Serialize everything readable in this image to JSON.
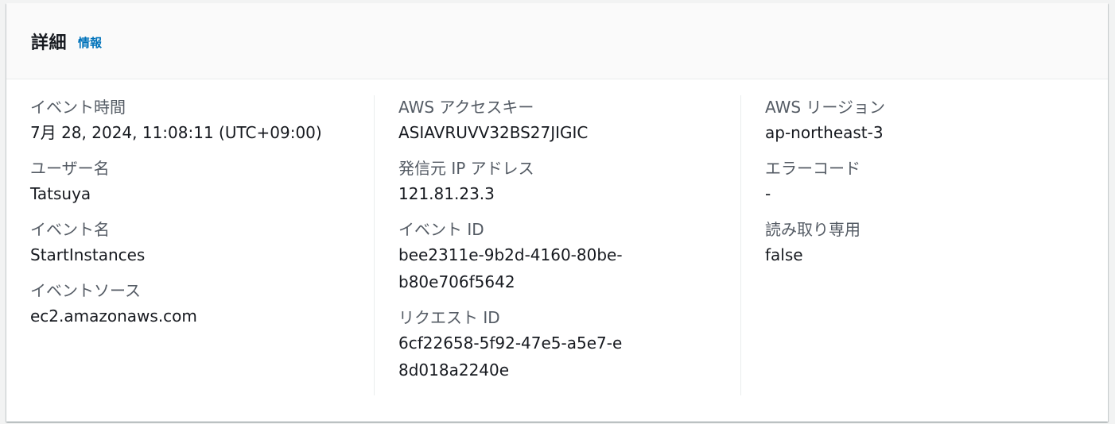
{
  "header": {
    "title": "詳細",
    "info_link": "情報"
  },
  "columns": [
    {
      "fields": [
        {
          "label": "イベント時間",
          "value": "7月 28, 2024, 11:08:11 (UTC+09:00)"
        },
        {
          "label": "ユーザー名",
          "value": "Tatsuya"
        },
        {
          "label": "イベント名",
          "value": "StartInstances"
        },
        {
          "label": "イベントソース",
          "value": "ec2.amazonaws.com"
        }
      ]
    },
    {
      "fields": [
        {
          "label": "AWS アクセスキー",
          "value": "ASIAVRUVV32BS27JIGIC"
        },
        {
          "label": "発信元 IP アドレス",
          "value": "121.81.23.3"
        },
        {
          "label": "イベント ID",
          "value": "bee2311e-9b2d-4160-80be-b80e706f5642"
        },
        {
          "label": "リクエスト ID",
          "value": "6cf22658-5f92-47e5-a5e7-e8d018a2240e"
        }
      ]
    },
    {
      "fields": [
        {
          "label": "AWS リージョン",
          "value": "ap-northeast-3"
        },
        {
          "label": "エラーコード",
          "value": "-"
        },
        {
          "label": "読み取り専用",
          "value": "false"
        }
      ]
    }
  ],
  "colors": {
    "accent_link": "#0073bb",
    "label_text": "#545b64",
    "value_text": "#16191f",
    "header_bg": "#fafafa"
  }
}
